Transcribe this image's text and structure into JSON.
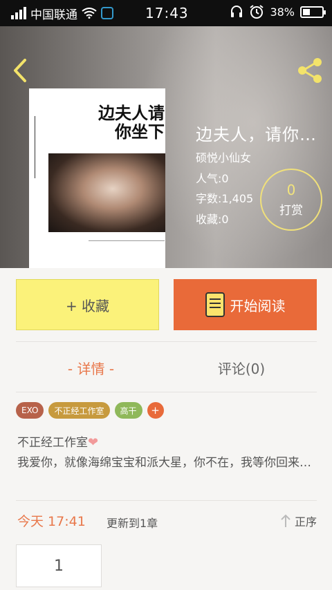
{
  "status_bar": {
    "carrier": "中国联通",
    "time": "17:43",
    "battery_percent": "38%",
    "battery_level": 0.38
  },
  "header": {
    "back_icon": "chevron-left-icon",
    "share_icon": "share-icon",
    "accent_color": "#f3e36a"
  },
  "cover": {
    "title": "边夫人请你坐下"
  },
  "book": {
    "title": "边夫人，请你…",
    "author": "硕悦小仙女",
    "popularity": "人气:0",
    "word_count": "字数:1,405",
    "favorites": "收藏:0"
  },
  "reward": {
    "count": "0",
    "label": "打赏"
  },
  "actions": {
    "collect_label": "+ 收藏",
    "read_label": "开始阅读",
    "collect_color": "#fbf27a",
    "read_color": "#e96a39"
  },
  "tabs": {
    "details": "- 详情 -",
    "comments": "评论(0)"
  },
  "tags": [
    {
      "label": "EXO",
      "color": "#b7624a"
    },
    {
      "label": "不正经工作室",
      "color": "#c79a3e"
    },
    {
      "label": "高干",
      "color": "#8fb85a"
    }
  ],
  "tag_add_label": "+",
  "intro": {
    "line1": "不正经工作室",
    "line2": "我爱你，就像海绵宝宝和派大星，你不在，我等你回来…"
  },
  "update": {
    "time": "今天 17:41",
    "note": "更新到1章",
    "sort_label": "正序"
  },
  "chapters": [
    "1"
  ]
}
